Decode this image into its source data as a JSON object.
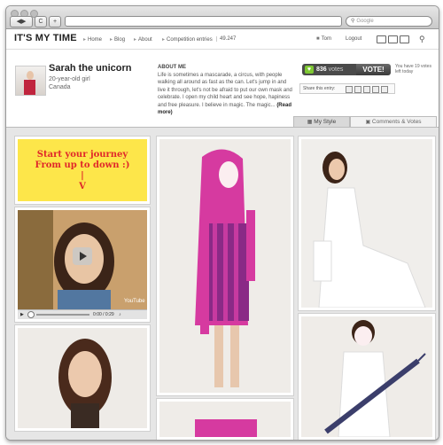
{
  "browser": {
    "nav_back": "◀",
    "nav_forward": "▶",
    "reload": "C",
    "new_tab": "+",
    "search_placeholder": "Google",
    "search_icon": "magnifier-icon"
  },
  "site": {
    "logo": "IT'S MY TIME",
    "nav": [
      "Home",
      "Blog",
      "About",
      "Competition entries"
    ],
    "entry_count": "49.247",
    "user": "Tom",
    "logout": "Logout"
  },
  "profile": {
    "name": "Sarah the unicorn",
    "subtitle": "20-year-old girl",
    "country": "Canada",
    "about_title": "ABOUT ME",
    "about_text": "Life is sometimes a mascarade, a circus, with people walking all around as fast as the can. Let's jump in and live it through, let's not be afraid to put our own mask and celebrate. I open my child heart and see hope, hapiness and free pleasure. I believe in magic. The magic...",
    "read_more": "(Read more)",
    "votes_count": "836",
    "votes_label": "votes",
    "vote_button": "VOTE!",
    "votes_left": "You have 19 votes left today",
    "share_label": "Share this entry:"
  },
  "tabs": {
    "my_style": "My Style",
    "comments": "Comments & Votes"
  },
  "gallery": {
    "journey_text_line1": "Start your journey",
    "journey_text_line2": "From up to down :)",
    "journey_text_line3": "|",
    "journey_text_line4": "V",
    "video_time": "0:00 / 0:29",
    "video_badge": "YouTube"
  },
  "colors": {
    "vote_green": "#7ec832",
    "journey_yellow": "#fde64a",
    "journey_red": "#e0282a",
    "pink_dress": "#d63aa0"
  }
}
